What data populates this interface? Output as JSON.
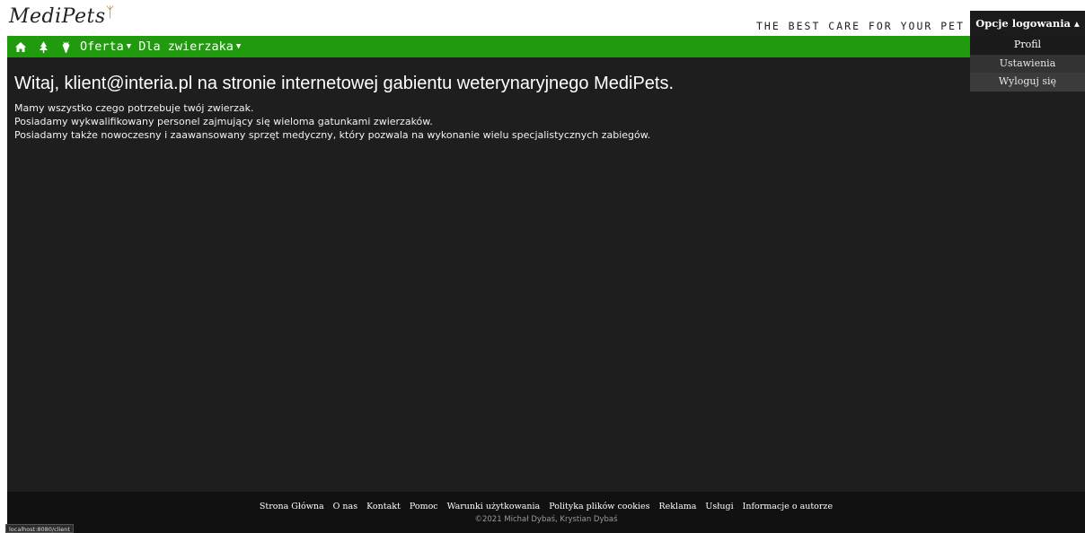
{
  "brand": {
    "logo_text": "MediPets",
    "tagline": "THE BEST CARE FOR YOUR PET"
  },
  "login": {
    "toggle_label": "Opcje logowania",
    "toggle_icon": "caret-up-icon",
    "items": [
      "Profil",
      "Ustawienia",
      "Wyloguj się"
    ]
  },
  "nav": {
    "icons": [
      "home-icon",
      "tree-icon",
      "carrot-icon"
    ],
    "links": [
      {
        "label": "Oferta",
        "icon": "caret-down-icon"
      },
      {
        "label": "Dla zwierzaka",
        "icon": "caret-down-icon"
      }
    ]
  },
  "main": {
    "heading": "Witaj, klient@interia.pl na stronie internetowej gabientu weterynaryjnego MediPets.",
    "paragraphs": [
      "Mamy wszystko czego potrzebuje twój zwierzak.",
      "Posiadamy wykwalifikowany personel zajmujący się wieloma gatunkami zwierzaków.",
      "Posiadamy także nowoczesny i zaawansowany sprzęt medyczny, który pozwala na wykonanie wielu specjalistycznych zabiegów."
    ]
  },
  "footer": {
    "links": [
      "Strona Główna",
      "O nas",
      "Kontakt",
      "Pomoc",
      "Warunki użytkowania",
      "Polityka plików cookies",
      "Reklama",
      "Usługi",
      "Informacje o autorze"
    ],
    "copyright": "©2021 Michał Dybaś, Krystian Dybaś"
  },
  "status_bar": {
    "url": "localhost:8080/client"
  },
  "colors": {
    "nav_green": "#1f9b0d",
    "content_bg": "#1e1e1e",
    "footer_bg": "#111111",
    "dropdown_bg": "#2b2b2b"
  }
}
